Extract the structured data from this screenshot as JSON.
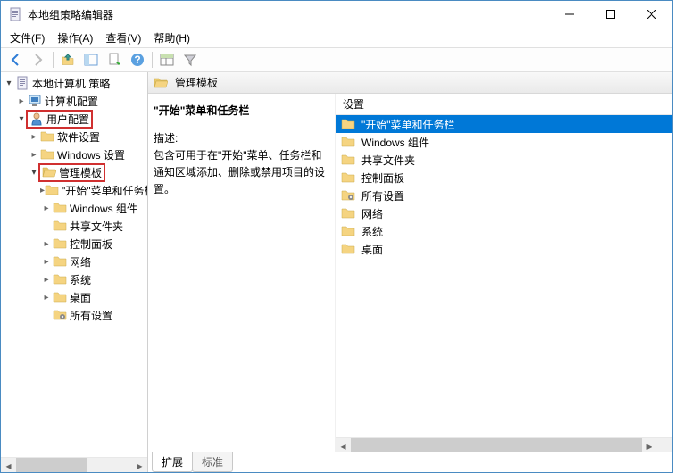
{
  "window": {
    "title": "本地组策略编辑器"
  },
  "menu": {
    "file": "文件(F)",
    "action": "操作(A)",
    "view": "查看(V)",
    "help": "帮助(H)"
  },
  "tree": {
    "root": "本地计算机 策略",
    "comp_config": "计算机配置",
    "user_config": "用户配置",
    "soft_settings": "软件设置",
    "win_settings": "Windows 设置",
    "admin_templates": "管理模板",
    "start_taskbar": "\"开始\"菜单和任务栏",
    "win_components": "Windows 组件",
    "shared_folders": "共享文件夹",
    "control_panel": "控制面板",
    "network": "网络",
    "system": "系统",
    "desktop": "桌面",
    "all_settings": "所有设置"
  },
  "detail": {
    "header_title": "管理模板",
    "left_heading": "\"开始\"菜单和任务栏",
    "desc_label": "描述:",
    "desc": "包含可用于在\"开始\"菜单、任务栏和通知区域添加、删除或禁用项目的设置。",
    "col_header": "设置",
    "items": [
      {
        "label": "\"开始\"菜单和任务栏",
        "selected": true
      },
      {
        "label": "Windows 组件",
        "selected": false
      },
      {
        "label": "共享文件夹",
        "selected": false
      },
      {
        "label": "控制面板",
        "selected": false
      },
      {
        "label": "所有设置",
        "selected": false,
        "special": true
      },
      {
        "label": "网络",
        "selected": false
      },
      {
        "label": "系统",
        "selected": false
      },
      {
        "label": "桌面",
        "selected": false
      }
    ]
  },
  "tabs": {
    "extended": "扩展",
    "standard": "标准"
  }
}
